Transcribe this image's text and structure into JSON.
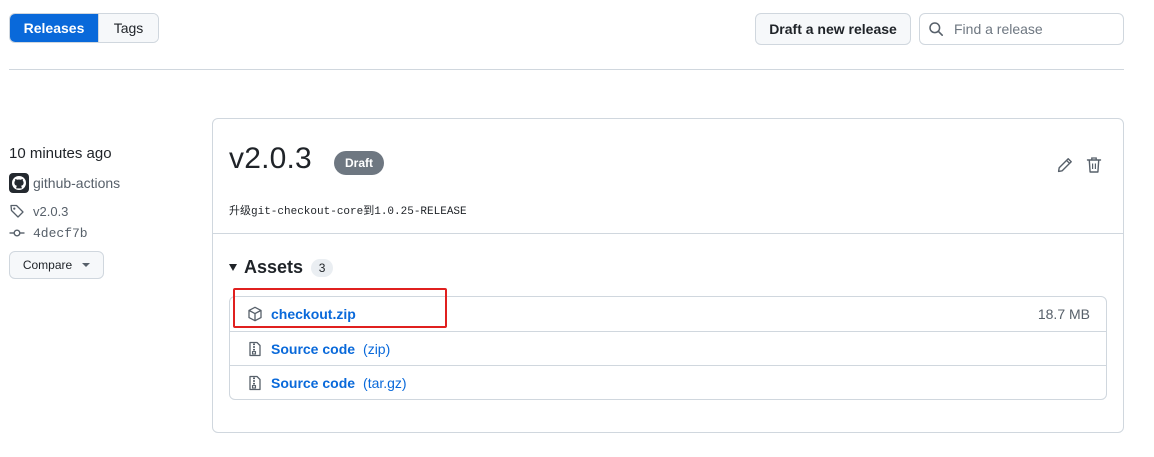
{
  "nav": {
    "tabs": [
      {
        "label": "Releases",
        "active": true
      },
      {
        "label": "Tags",
        "active": false
      }
    ],
    "draft_button": "Draft a new release",
    "search": {
      "placeholder": "Find a release",
      "value": ""
    }
  },
  "release": {
    "time_ago": "10 minutes ago",
    "author": "github-actions",
    "tag": "v2.0.3",
    "commit": "4decf7b",
    "compare_label": "Compare",
    "title": "v2.0.3",
    "badge": "Draft",
    "description": "升级git-checkout-core到1.0.25-RELEASE",
    "assets": {
      "title": "Assets",
      "count": "3",
      "items": [
        {
          "icon": "package-icon",
          "name": "checkout.zip",
          "suffix": "",
          "size": "18.7 MB"
        },
        {
          "icon": "file-zip-icon",
          "name": "Source code",
          "suffix": "(zip)",
          "size": ""
        },
        {
          "icon": "file-zip-icon",
          "name": "Source code",
          "suffix": "(tar.gz)",
          "size": ""
        }
      ]
    }
  },
  "colors": {
    "accent": "#0969da",
    "border": "#d0d7de",
    "badge_bg": "#6e7781",
    "highlight": "#e0201f"
  }
}
